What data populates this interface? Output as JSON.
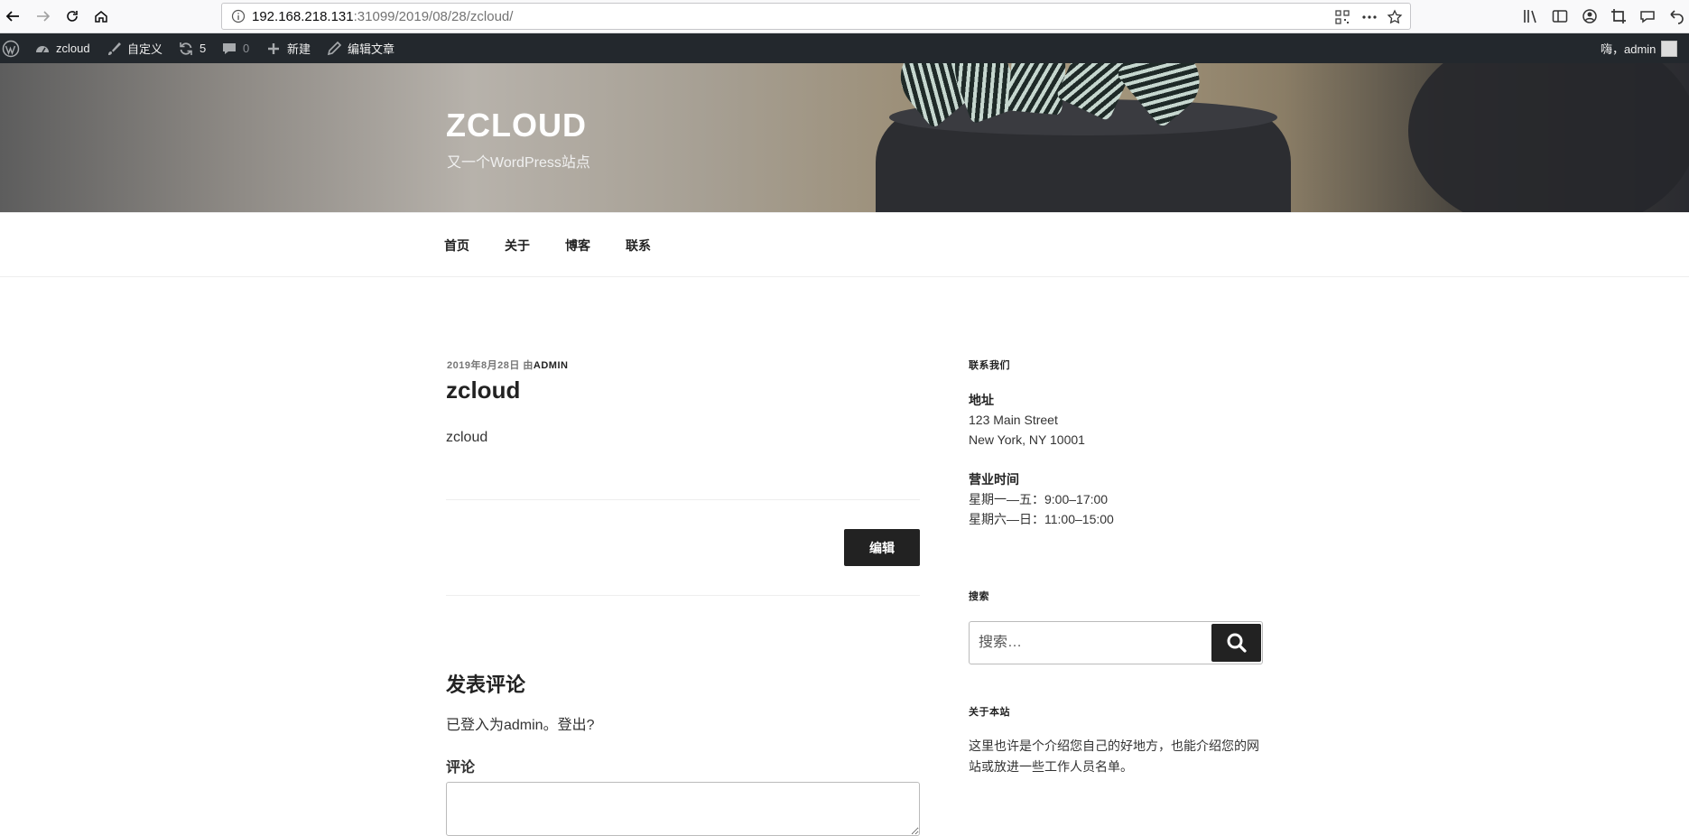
{
  "browser": {
    "url_host": "192.168.218.131",
    "url_path": ":31099/2019/08/28/zcloud/"
  },
  "adminbar": {
    "site_name": "zcloud",
    "customize": "自定义",
    "updates_count": "5",
    "comments_count": "0",
    "new_label": "新建",
    "edit_post": "编辑文章",
    "greeting": "嗨，admin"
  },
  "header": {
    "site_title": "ZCLOUD",
    "site_description": "又一个WordPress站点"
  },
  "nav": {
    "items": [
      "首页",
      "关于",
      "博客",
      "联系"
    ]
  },
  "post": {
    "date": "2019年8月28日",
    "by": "由",
    "author": "ADMIN",
    "title": "zcloud",
    "body": "zcloud",
    "edit_label": "编辑"
  },
  "comments": {
    "reply_title": "发表评论",
    "logged_in_text": "已登入为admin。登出?",
    "comment_label": "评论"
  },
  "sidebar": {
    "contact_title": "联系我们",
    "address_label": "地址",
    "address_line1": "123 Main Street",
    "address_line2": "New York, NY 10001",
    "hours_label": "营业时间",
    "hours_weekday": "星期一—五：9:00–17:00",
    "hours_weekend": "星期六—日：11:00–15:00",
    "search_title": "搜索",
    "search_placeholder": "搜索…",
    "about_title": "关于本站",
    "about_text": "这里也许是个介绍您自己的好地方，也能介绍您的网站或放进一些工作人员名单。"
  }
}
